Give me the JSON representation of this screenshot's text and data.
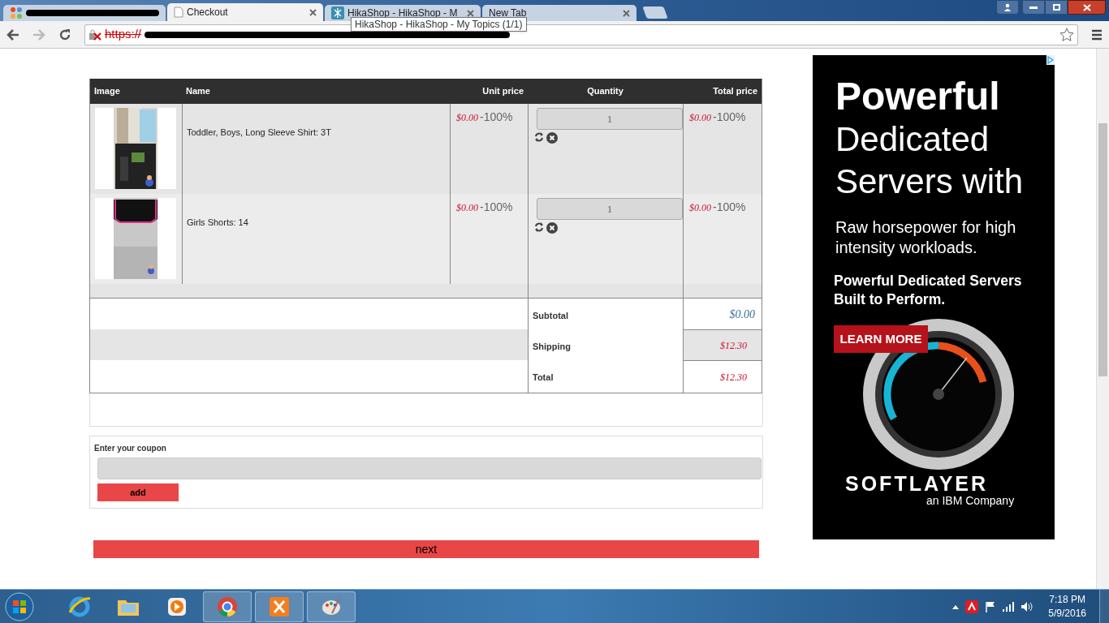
{
  "browser": {
    "tabs": [
      {
        "selected": false
      },
      {
        "title": "Checkout",
        "selected": true
      },
      {
        "title": "HikaShop - HikaShop - M",
        "selected": false
      },
      {
        "title": "New Tab",
        "selected": false
      }
    ],
    "tooltip": "HikaShop - HikaShop - My Topics (1/1)",
    "url": "https://"
  },
  "cart": {
    "columns": [
      "Image",
      "Name",
      "Unit price",
      "Quantity",
      "Total price"
    ],
    "items": [
      {
        "name": "Toddler, Boys, Long Sleeve Shirt: 3T",
        "unit_price": "$0.00",
        "unit_discount": "-100%",
        "quantity": "1",
        "total_price": "$0.00",
        "total_discount": "-100%"
      },
      {
        "name": "Girls Shorts: 14",
        "unit_price": "$0.00",
        "unit_discount": "-100%",
        "quantity": "1",
        "total_price": "$0.00",
        "total_discount": "-100%"
      }
    ],
    "totals": [
      {
        "label": "Subtotal",
        "value": "$0.00",
        "color": "#3a6f9a"
      },
      {
        "label": "Shipping",
        "value": "$12.30",
        "color": "#c8102e"
      },
      {
        "label": "Total",
        "value": "$12.30",
        "color": "#c8102e"
      }
    ]
  },
  "coupon": {
    "label": "Enter your coupon",
    "button": "add"
  },
  "next_button": "next",
  "ad": {
    "headline": "Powerful",
    "headline_light": [
      "Dedicated",
      "Servers with"
    ],
    "body": "Raw horsepower for high intensity workloads.",
    "tagline": "Powerful Dedicated Servers Built to Perform.",
    "button": "LEARN MORE",
    "logo": "SOFTLAYER",
    "logo_sub": "an IBM Company"
  },
  "taskbar": {
    "time": "7:18 PM",
    "date": "5/9/2016"
  }
}
